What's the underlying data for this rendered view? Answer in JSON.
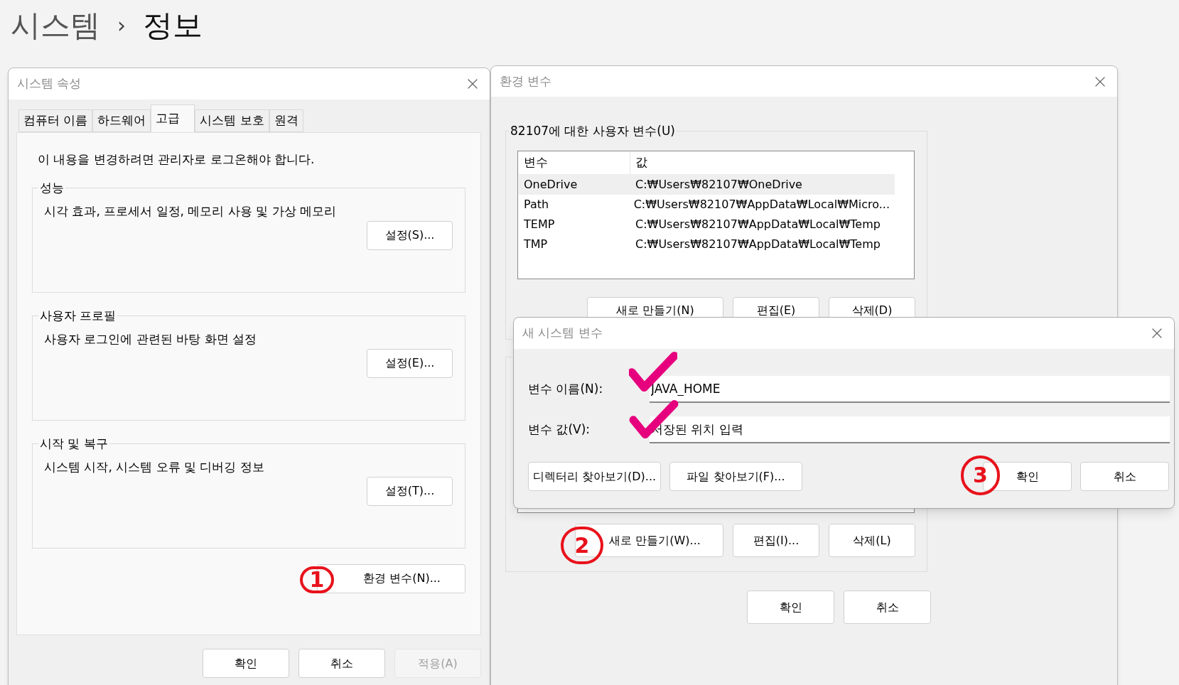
{
  "breadcrumb": {
    "items": [
      "시스템",
      "정보"
    ],
    "separator": "›"
  },
  "system_properties": {
    "title": "시스템 속성",
    "tabs": [
      {
        "label": "컴퓨터 이름",
        "selected": false
      },
      {
        "label": "하드웨어",
        "selected": false
      },
      {
        "label": "고급",
        "selected": true
      },
      {
        "label": "시스템 보호",
        "selected": false
      },
      {
        "label": "원격",
        "selected": false
      }
    ],
    "notice": "이 내용을 변경하려면 관리자로 로그온해야 합니다.",
    "groups": [
      {
        "title": "성능",
        "description": "시각 효과, 프로세서 일정, 메모리 사용 및 가상 메모리",
        "button": "설정(S)..."
      },
      {
        "title": "사용자 프로필",
        "description": "사용자 로그인에 관련된 바탕 화면 설정",
        "button": "설정(E)..."
      },
      {
        "title": "시작 및 복구",
        "description": "시스템 시작, 시스템 오류 및 디버깅 정보",
        "button": "설정(T)..."
      }
    ],
    "env_button": "환경 변수(N)...",
    "buttons": [
      {
        "label": "확인",
        "disabled": false
      },
      {
        "label": "취소",
        "disabled": false
      },
      {
        "label": "적용(A)",
        "disabled": true
      }
    ]
  },
  "environment_variables": {
    "title": "환경 변수",
    "user_group": {
      "title": "82107에 대한 사용자 변수(U)",
      "columns": [
        "변수",
        "값"
      ],
      "rows": [
        {
          "name": "OneDrive",
          "value": "C:₩Users₩82107₩OneDrive",
          "selected": true
        },
        {
          "name": "Path",
          "value": "C:₩Users₩82107₩AppData₩Local₩Micro...",
          "selected": false
        },
        {
          "name": "TEMP",
          "value": "C:₩Users₩82107₩AppData₩Local₩Temp",
          "selected": false
        },
        {
          "name": "TMP",
          "value": "C:₩Users₩82107₩AppData₩Local₩Temp",
          "selected": false
        }
      ],
      "buttons": [
        "새로 만들기(N)",
        "편집(E)",
        "삭제(D)"
      ]
    },
    "system_group": {
      "buttons": [
        "새로 만들기(W)...",
        "편집(I)...",
        "삭제(L)"
      ]
    },
    "buttons": [
      "확인",
      "취소"
    ]
  },
  "new_system_variable": {
    "title": "새 시스템 변수",
    "fields": [
      {
        "label": "변수 이름(N):",
        "value": "JAVA_HOME"
      },
      {
        "label": "변수 값(V):",
        "value": "저장된 위치 입력"
      }
    ],
    "browse_buttons": [
      "디렉터리 찾아보기(D)...",
      "파일 찾아보기(F)..."
    ],
    "buttons": [
      "확인",
      "취소"
    ]
  },
  "annotations": [
    {
      "kind": "check"
    },
    {
      "kind": "check"
    },
    {
      "kind": "number",
      "label": "1"
    },
    {
      "kind": "number",
      "label": "2"
    },
    {
      "kind": "number",
      "label": "3"
    }
  ]
}
